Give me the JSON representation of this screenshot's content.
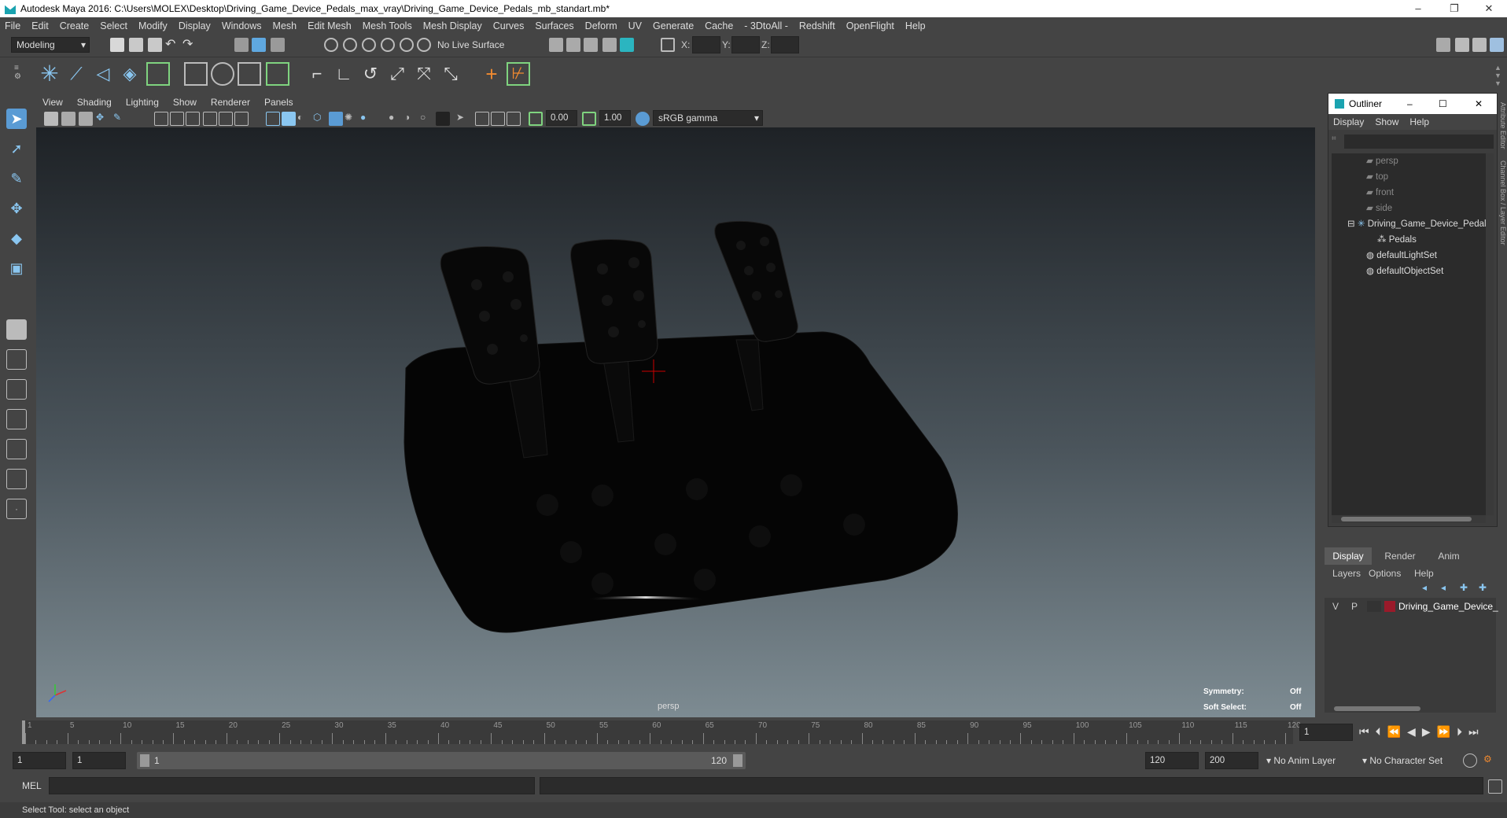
{
  "window": {
    "title": "Autodesk Maya 2016: C:\\Users\\MOLEX\\Desktop\\Driving_Game_Device_Pedals_max_vray\\Driving_Game_Device_Pedals_mb_standart.mb*",
    "minimize": "–",
    "restore": "❐",
    "close": "✕"
  },
  "menubar": [
    "File",
    "Edit",
    "Create",
    "Select",
    "Modify",
    "Display",
    "Windows",
    "Mesh",
    "Edit Mesh",
    "Mesh Tools",
    "Mesh Display",
    "Curves",
    "Surfaces",
    "Deform",
    "UV",
    "Generate",
    "Cache",
    "- 3DtoAll -",
    "Redshift",
    "OpenFlight",
    "Help"
  ],
  "statusline": {
    "mode": "Modeling",
    "live_surface": "No Live Surface",
    "x_label": "X:",
    "y_label": "Y:",
    "z_label": "Z:"
  },
  "panel_menu": [
    "View",
    "Shading",
    "Lighting",
    "Show",
    "Renderer",
    "Panels"
  ],
  "panel_toolbar": {
    "exposure": "0.00",
    "gamma": "1.00",
    "color_space": "sRGB gamma"
  },
  "viewport": {
    "camera_label": "persp",
    "symmetry_label": "Symmetry:",
    "symmetry_value": "Off",
    "soft_select_label": "Soft Select:",
    "soft_select_value": "Off"
  },
  "outliner": {
    "title": "Outliner",
    "menu": [
      "Display",
      "Show",
      "Help"
    ],
    "items": [
      "persp",
      "top",
      "front",
      "side",
      "Driving_Game_Device_Pedals",
      "Pedals",
      "defaultLightSet",
      "defaultObjectSet"
    ]
  },
  "side_tabs": {
    "attribute_editor": "Attribute Editor",
    "channel_box": "Channel Box / Layer Editor"
  },
  "layer_editor": {
    "tabs": [
      "Display",
      "Render",
      "Anim"
    ],
    "menu": [
      "Layers",
      "Options",
      "Help"
    ],
    "layer": {
      "visible": "V",
      "playback": "P",
      "name": "Driving_Game_Device_",
      "color": "#9a1a2a"
    }
  },
  "timeline": {
    "ticks": [
      "1",
      "5",
      "10",
      "15",
      "20",
      "25",
      "30",
      "35",
      "40",
      "45",
      "50",
      "55",
      "60",
      "65",
      "70",
      "75",
      "80",
      "85",
      "90",
      "95",
      "100",
      "105",
      "110",
      "115",
      "120"
    ],
    "current_frame": "1"
  },
  "range": {
    "start": "1",
    "playback_start": "1",
    "slider_start": "1",
    "slider_end": "120",
    "playback_end": "120",
    "end": "200",
    "anim_layer": "No Anim Layer",
    "character_set": "No Character Set"
  },
  "cmdline": {
    "label": "MEL"
  },
  "helpline": {
    "text": "Select Tool: select an object"
  }
}
